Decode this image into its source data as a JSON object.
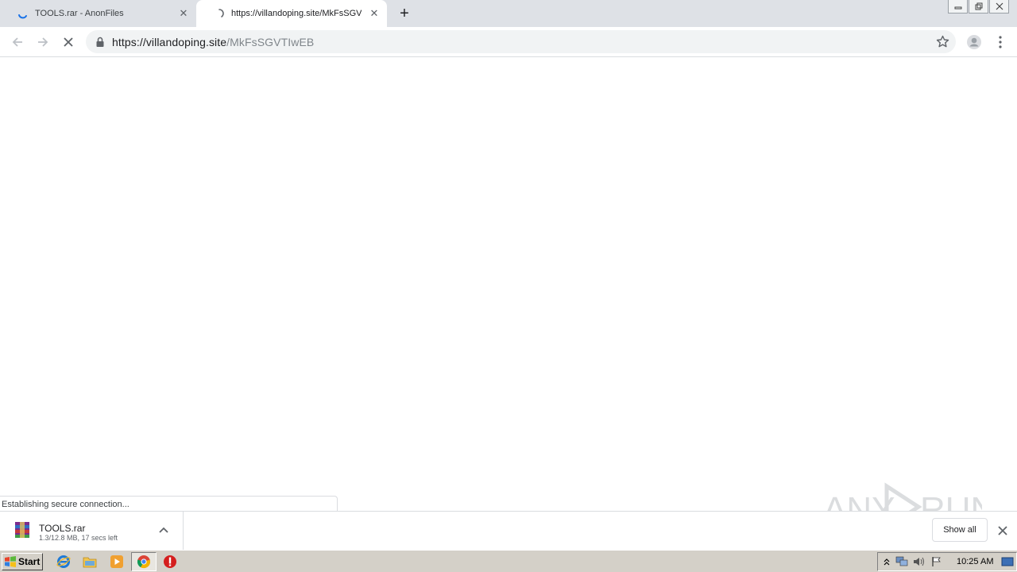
{
  "tabs": [
    {
      "title": "TOOLS.rar - AnonFiles",
      "close_icon": "close-icon",
      "loading": true
    },
    {
      "title": "https://villandoping.site/MkFsSGVTI",
      "close_icon": "close-icon",
      "loading": true,
      "active": true
    }
  ],
  "toolbar": {
    "url_host": "https://villandoping.site",
    "url_path": "/MkFsSGVTIwEB"
  },
  "status_bubble": "Establishing secure connection...",
  "download": {
    "filename": "TOOLS.rar",
    "status": "1.3/12.8 MB, 17 secs left",
    "show_all": "Show all"
  },
  "watermark": {
    "text_left": "ANY",
    "text_right": "RUN"
  },
  "taskbar": {
    "start": "Start",
    "clock": "10:25 AM"
  },
  "colors": {
    "tabstrip": "#dee1e6",
    "omnibox": "#f1f3f4",
    "taskbar": "#d4d0c8",
    "chrome_blue": "#1a73e8"
  }
}
